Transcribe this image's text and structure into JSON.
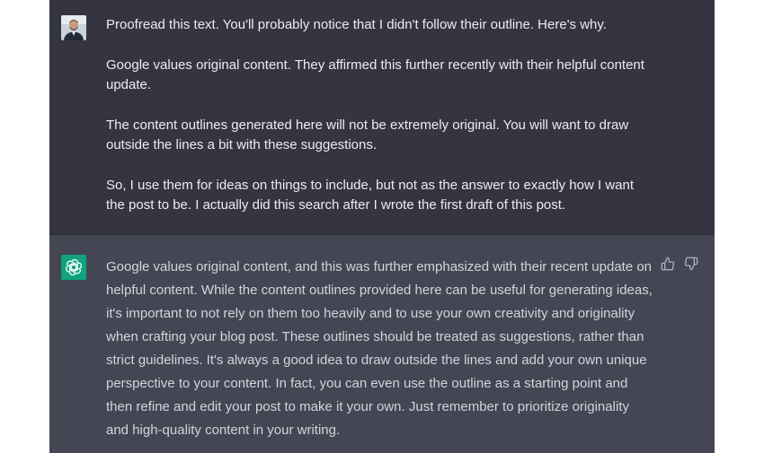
{
  "user_message": {
    "paragraphs": [
      "Proofread this text. You'll probably notice that I didn't follow their outline. Here's why.",
      "Google values original content. They affirmed this further recently with their helpful content update.",
      "The content outlines generated here will not be extremely original. You will want to draw outside the lines a bit with these suggestions.",
      "So, I use them for ideas on things to include, but not as the answer to exactly how I want the post to be. I actually did this search after I wrote the first draft of this post."
    ],
    "avatar_icon": "user-avatar-photo"
  },
  "assistant_message": {
    "text": "Google values original content, and this was further emphasized with their recent update on helpful content. While the content outlines provided here can be useful for generating ideas, it's important to not rely on them too heavily and to use your own creativity and originality when crafting your blog post. These outlines should be treated as suggestions, rather than strict guidelines. It's always a good idea to draw outside the lines and add your own unique perspective to your content. In fact, you can even use the outline as a starting point and then refine and edit your post to make it your own. Just remember to prioritize originality and high-quality content in your writing.",
    "avatar_icon": "openai-logo-icon",
    "feedback_icons": [
      "thumbs-up-icon",
      "thumbs-down-icon"
    ]
  },
  "colors": {
    "user_bg": "#343541",
    "assistant_bg": "#444654",
    "assistant_avatar_bg": "#10a37f",
    "user_text": "#ececf1",
    "assistant_text": "#d1d5db"
  }
}
